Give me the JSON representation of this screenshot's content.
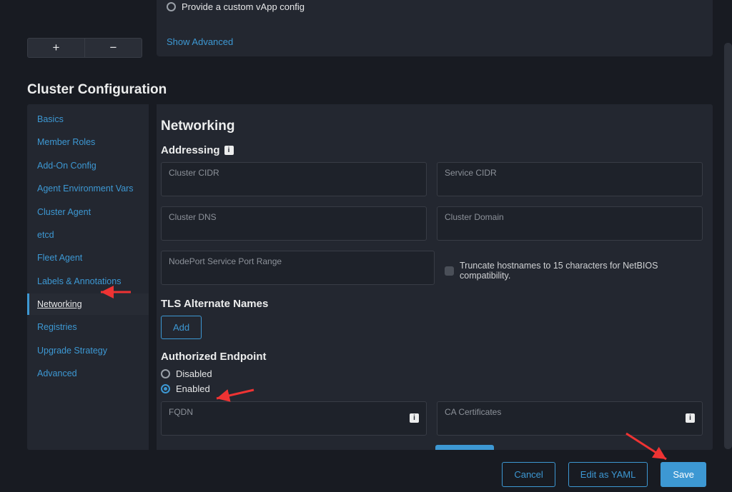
{
  "top": {
    "custom_vapp_label": "Provide a custom vApp config",
    "show_advanced": "Show Advanced"
  },
  "pm": {
    "plus": "+",
    "minus": "−"
  },
  "section_title": "Cluster Configuration",
  "sidebar": {
    "items": [
      {
        "label": "Basics"
      },
      {
        "label": "Member Roles"
      },
      {
        "label": "Add-On Config"
      },
      {
        "label": "Agent Environment Vars"
      },
      {
        "label": "Cluster Agent"
      },
      {
        "label": "etcd"
      },
      {
        "label": "Fleet Agent"
      },
      {
        "label": "Labels & Annotations"
      },
      {
        "label": "Networking"
      },
      {
        "label": "Registries"
      },
      {
        "label": "Upgrade Strategy"
      },
      {
        "label": "Advanced"
      }
    ],
    "active_index": 8
  },
  "panel": {
    "title": "Networking",
    "addressing_title": "Addressing",
    "cluster_cidr": "Cluster CIDR",
    "service_cidr": "Service CIDR",
    "cluster_dns": "Cluster DNS",
    "cluster_domain": "Cluster Domain",
    "nodeport_range": "NodePort Service Port Range",
    "truncate_label": "Truncate hostnames to 15 characters for NetBIOS compatibility.",
    "tls_alt_title": "TLS Alternate Names",
    "add_label": "Add",
    "auth_title": "Authorized Endpoint",
    "disabled_label": "Disabled",
    "enabled_label": "Enabled",
    "fqdn_label": "FQDN",
    "ca_cert_label": "CA Certificates",
    "info_glyph": "i"
  },
  "footer": {
    "cancel": "Cancel",
    "edit_yaml": "Edit as YAML",
    "save": "Save"
  }
}
